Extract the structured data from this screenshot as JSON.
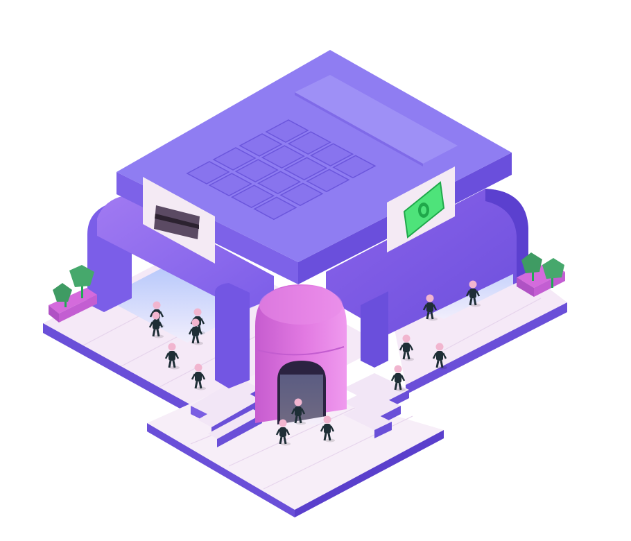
{
  "scene": {
    "subject": "isometric-bank-building",
    "colors": {
      "background": "#ffffff",
      "roof_top": "#8f7df2",
      "roof_left": "#7a62e6",
      "roof_right": "#6a4fdc",
      "wing_top": "#9a72f0",
      "wing_face": "#7656e6",
      "dome": "#e27ae2",
      "dome_shadow": "#c25ccf",
      "plaza": "#f3e6f6",
      "plaza_edge": "#6a4fd8",
      "sign_panel": "#f4eaf4",
      "banknote": "#4ee37a",
      "card": "#5b4a63",
      "tree": "#3f9b63",
      "planter": "#d46bdc",
      "person_body": "#1e2e36",
      "person_head": "#f1b5cf"
    },
    "signs": [
      {
        "icon": "credit-card-icon"
      },
      {
        "icon": "banknote-icon"
      }
    ],
    "roof_feature": "calculator-keypad",
    "people_count": 14,
    "planter_count": 2
  }
}
